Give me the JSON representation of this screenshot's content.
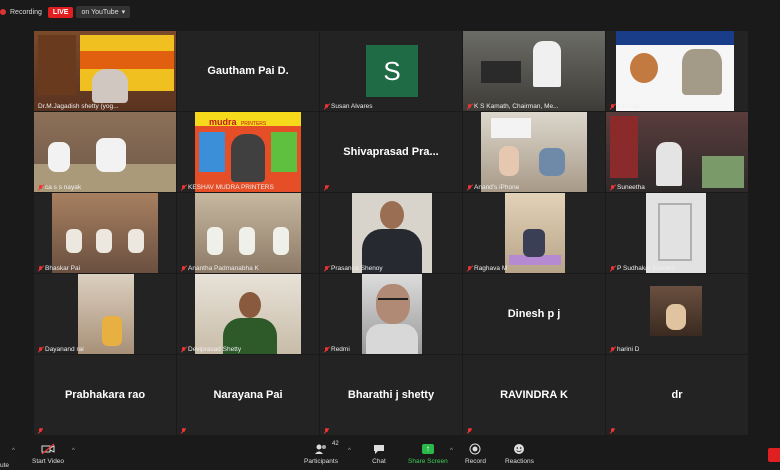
{
  "topbar": {
    "recording_label": "Recording",
    "live_label": "LIVE",
    "youtube_label": "on YouTube"
  },
  "tiles": [
    {
      "name": "Dr.M.Jagadish shetty (yog...",
      "type": "video",
      "active": true
    },
    {
      "name": "Gautham Pai D.",
      "type": "name"
    },
    {
      "name": "Susan Alvares",
      "type": "avatar",
      "initial": "S"
    },
    {
      "name": "K S Kamath, Chairman, Me...",
      "type": "video"
    },
    {
      "name": "A1 Logi...",
      "type": "video"
    },
    {
      "name": "ca s s nayak",
      "type": "video"
    },
    {
      "name": "KESHAV MUDRA PRINTERS",
      "type": "video"
    },
    {
      "name": "Shivaprasad  Pra...",
      "type": "name"
    },
    {
      "name": "Anand's iPhone",
      "type": "video"
    },
    {
      "name": "Suneetha",
      "type": "video"
    },
    {
      "name": "Bhaskar  Pai",
      "type": "video"
    },
    {
      "name": "Anantha Padmanabha K",
      "type": "video"
    },
    {
      "name": "Prasanna Shenoy",
      "type": "video"
    },
    {
      "name": "Raghava M",
      "type": "video"
    },
    {
      "name": "P Sudhakar Kamath",
      "type": "video"
    },
    {
      "name": "Dayanand rai",
      "type": "video"
    },
    {
      "name": "Deviprasad Shetty",
      "type": "video"
    },
    {
      "name": "Redmi",
      "type": "video"
    },
    {
      "name": "Dinesh p j",
      "type": "name"
    },
    {
      "name": "harini D",
      "type": "video"
    },
    {
      "name": "Prabhakara rao",
      "type": "name"
    },
    {
      "name": "Narayana Pai",
      "type": "name"
    },
    {
      "name": "Bharathi j shetty",
      "type": "name"
    },
    {
      "name": "RAVINDRA K",
      "type": "name"
    },
    {
      "name": "dr",
      "type": "name"
    }
  ],
  "poster": {
    "brand": "mudra",
    "brand_suffix": "PRINTERS"
  },
  "toolbar": {
    "start_video": "Start Video",
    "participants": "Participants",
    "participants_count": "42",
    "chat": "Chat",
    "share_screen": "Share Screen",
    "record": "Record",
    "reactions": "Reactions",
    "left_clip": "ute"
  },
  "colors": {
    "live_badge": "#e02020",
    "active_speaker": "#f5e84b",
    "share_green": "#2cb84a",
    "avatar_bg": "#1f6b46",
    "mute_red": "#e33333"
  }
}
